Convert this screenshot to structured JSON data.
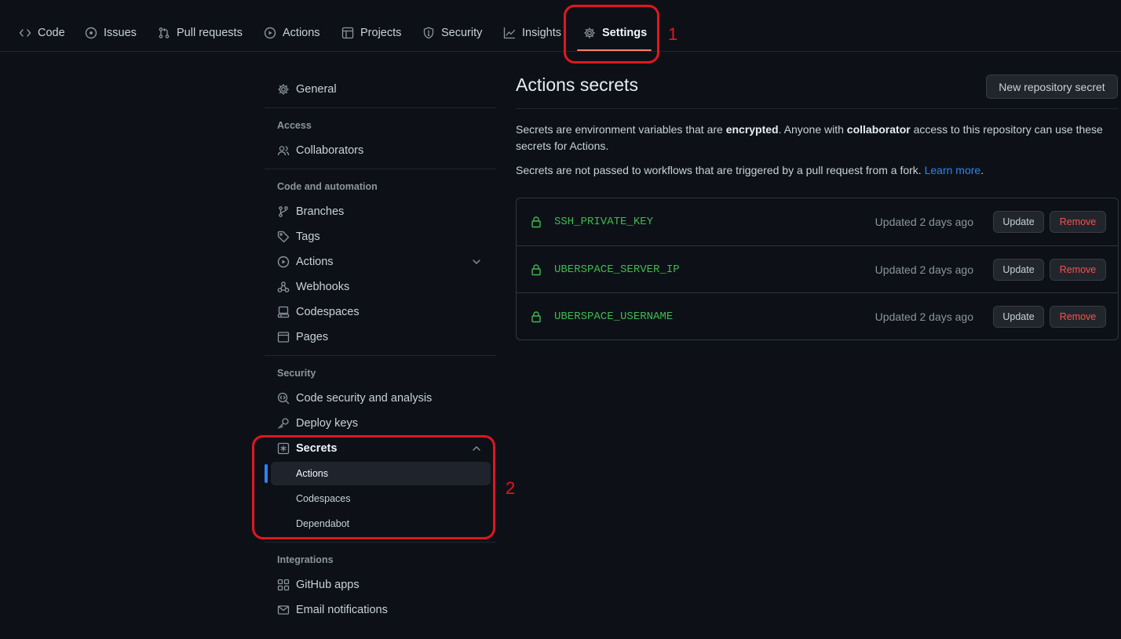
{
  "nav": {
    "tabs": [
      {
        "label": "Code",
        "icon": "code-icon"
      },
      {
        "label": "Issues",
        "icon": "issue-icon"
      },
      {
        "label": "Pull requests",
        "icon": "pull-request-icon"
      },
      {
        "label": "Actions",
        "icon": "play-icon"
      },
      {
        "label": "Projects",
        "icon": "table-icon"
      },
      {
        "label": "Security",
        "icon": "shield-icon"
      },
      {
        "label": "Insights",
        "icon": "graph-icon"
      },
      {
        "label": "Settings",
        "icon": "gear-icon",
        "active": true
      }
    ]
  },
  "annotations": {
    "first": "1",
    "second": "2",
    "color": "#e0171f"
  },
  "sidebar": {
    "general": "General",
    "access_heading": "Access",
    "collaborators": "Collaborators",
    "code_heading": "Code and automation",
    "branches": "Branches",
    "tags": "Tags",
    "actions": "Actions",
    "webhooks": "Webhooks",
    "codespaces": "Codespaces",
    "pages": "Pages",
    "security_heading": "Security",
    "code_security": "Code security and analysis",
    "deploy_keys": "Deploy keys",
    "secrets": "Secrets",
    "secrets_sub": [
      {
        "label": "Actions",
        "active": true
      },
      {
        "label": "Codespaces"
      },
      {
        "label": "Dependabot"
      }
    ],
    "integrations_heading": "Integrations",
    "github_apps": "GitHub apps",
    "email_notifications": "Email notifications"
  },
  "main": {
    "title": "Actions secrets",
    "new_button": "New repository secret",
    "desc1_a": "Secrets are environment variables that are ",
    "desc1_b": "encrypted",
    "desc1_c": ". Anyone with ",
    "desc1_d": "collaborator",
    "desc1_e": " access to this repository can use these secrets for Actions.",
    "desc2_a": "Secrets are not passed to workflows that are triggered by a pull request from a fork. ",
    "desc2_link": "Learn more",
    "desc2_end": ".",
    "secrets": [
      {
        "name": "SSH_PRIVATE_KEY",
        "updated": "Updated 2 days ago",
        "update": "Update",
        "remove": "Remove"
      },
      {
        "name": "UBERSPACE_SERVER_IP",
        "updated": "Updated 2 days ago",
        "update": "Update",
        "remove": "Remove"
      },
      {
        "name": "UBERSPACE_USERNAME",
        "updated": "Updated 2 days ago",
        "update": "Update",
        "remove": "Remove"
      }
    ]
  },
  "colors": {
    "accent": "#f78166",
    "link": "#2f81f7",
    "secret_green": "#3fb950",
    "danger": "#f85149"
  }
}
